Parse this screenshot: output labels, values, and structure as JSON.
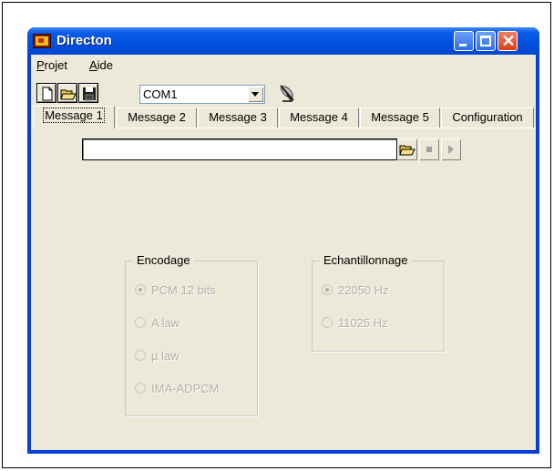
{
  "window": {
    "title": "Directon"
  },
  "menu": {
    "projet": "Projet",
    "aide": "Aide"
  },
  "toolbar": {
    "new_icon": "new-document-icon",
    "open_icon": "open-folder-icon",
    "save_icon": "save-disk-icon",
    "port_value": "COM1",
    "connect_icon": "satellite-dish-icon"
  },
  "tabs": [
    {
      "label": "Message 1",
      "active": true
    },
    {
      "label": "Message 2",
      "active": false
    },
    {
      "label": "Message 3",
      "active": false
    },
    {
      "label": "Message 4",
      "active": false
    },
    {
      "label": "Message 5",
      "active": false
    },
    {
      "label": "Configuration",
      "active": false
    }
  ],
  "file": {
    "path_value": "",
    "browse_icon": "open-folder-icon",
    "stop_icon": "stop-icon",
    "play_icon": "play-icon"
  },
  "encodage": {
    "title": "Encodage",
    "options": [
      {
        "label": "PCM 12 bits",
        "selected": true
      },
      {
        "label": "A law",
        "selected": false
      },
      {
        "label": "µ law",
        "selected": false
      },
      {
        "label": "IMA-ADPCM",
        "selected": false
      }
    ]
  },
  "echantillonnage": {
    "title": "Echantillonnage",
    "options": [
      {
        "label": "22050 Hz",
        "selected": true
      },
      {
        "label": "11025 Hz",
        "selected": false
      }
    ]
  },
  "colors": {
    "titlebar": "#0a5ce8",
    "client": "#ece9d8",
    "disabled_text": "#b0b0a8"
  }
}
